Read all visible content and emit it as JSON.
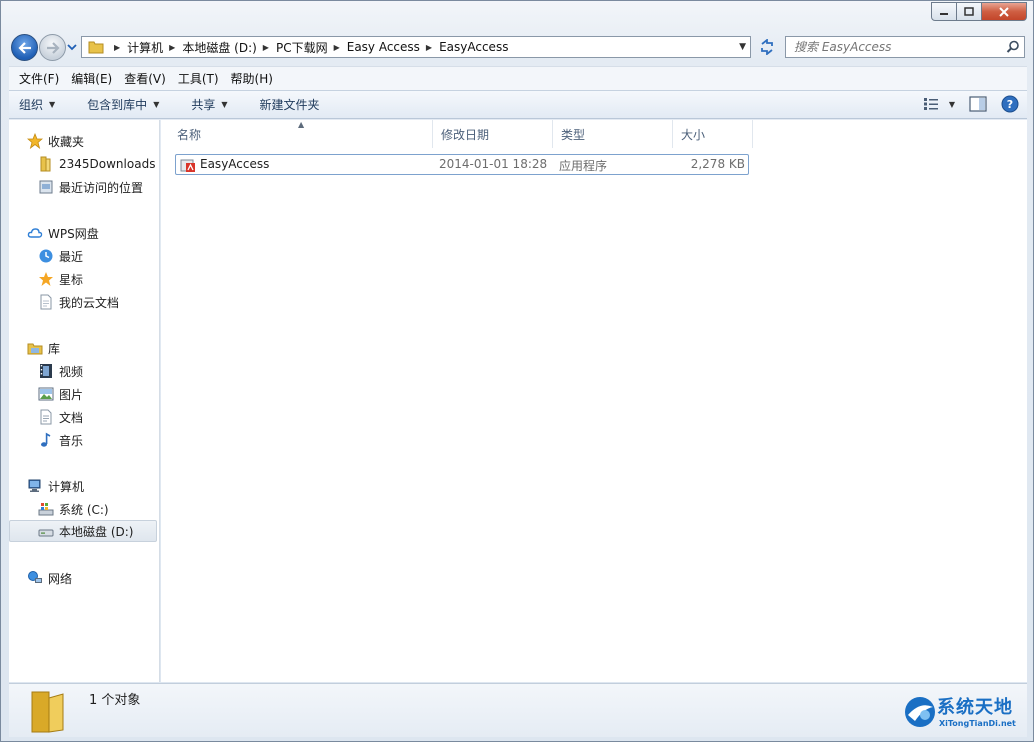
{
  "address": {
    "crumbs": [
      "计算机",
      "本地磁盘 (D:)",
      "PC下载网",
      "Easy Access",
      "EasyAccess"
    ]
  },
  "search": {
    "placeholder": "搜索 EasyAccess"
  },
  "menu": [
    "文件(F)",
    "编辑(E)",
    "查看(V)",
    "工具(T)",
    "帮助(H)"
  ],
  "toolbar": {
    "organize": "组织",
    "include_library": "包含到库中",
    "share": "共享",
    "new_folder": "新建文件夹"
  },
  "navpane": {
    "favorites": "收藏夹",
    "downloads": "2345Downloads",
    "recent_places": "最近访问的位置",
    "wps": "WPS网盘",
    "wps_recent": "最近",
    "wps_starred": "星标",
    "wps_docs": "我的云文档",
    "libraries": "库",
    "videos": "视频",
    "pictures": "图片",
    "documents": "文档",
    "music": "音乐",
    "computer": "计算机",
    "drive_c": "系统 (C:)",
    "drive_d": "本地磁盘 (D:)",
    "network": "网络"
  },
  "columns": {
    "name": "名称",
    "modified": "修改日期",
    "type": "类型",
    "size": "大小"
  },
  "files": [
    {
      "name": "EasyAccess",
      "modified": "2014-01-01 18:28",
      "type": "应用程序",
      "size": "2,278 KB"
    }
  ],
  "status": {
    "count": "1 个对象"
  },
  "watermark": {
    "title": "系统天地",
    "sub": "XiTongTianDi.net"
  },
  "colors": {
    "accent": "#1a6fc4",
    "nav_back": "#1f5fb5",
    "close": "#c3452a"
  }
}
